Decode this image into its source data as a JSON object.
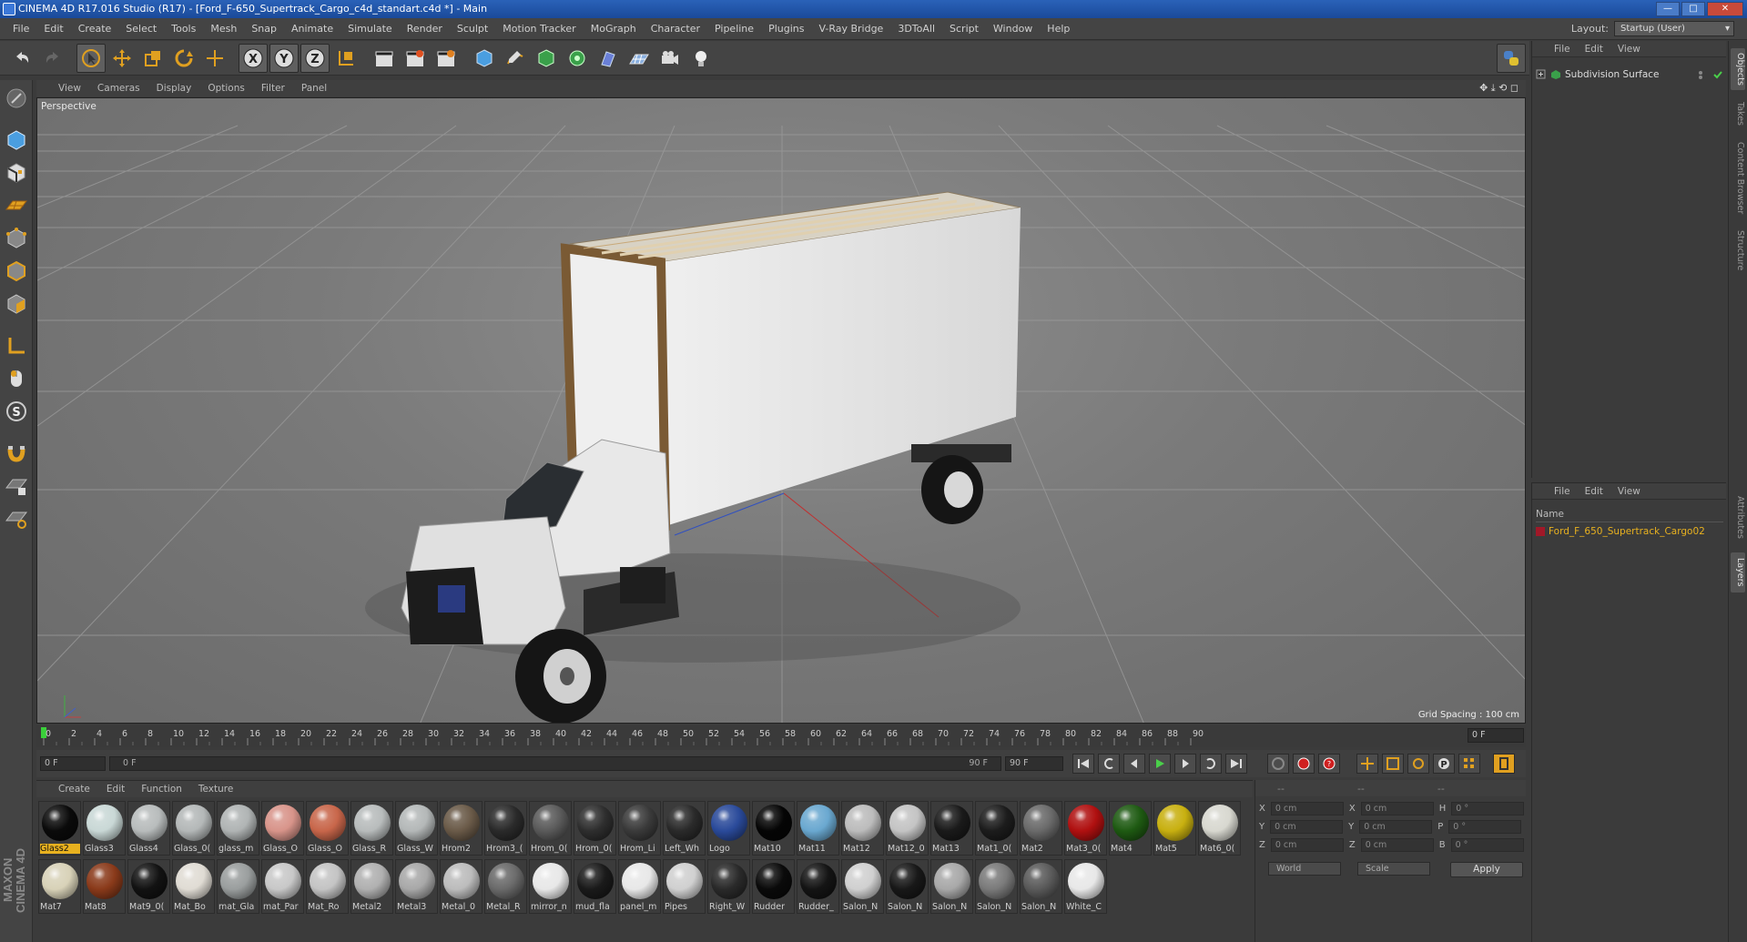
{
  "window": {
    "title": "CINEMA 4D R17.016 Studio (R17) - [Ford_F-650_Supertrack_Cargo_c4d_standart.c4d *] - Main",
    "btn_min": "—",
    "btn_max": "□",
    "btn_close": "✕"
  },
  "menu": [
    "File",
    "Edit",
    "Create",
    "Select",
    "Tools",
    "Mesh",
    "Snap",
    "Animate",
    "Simulate",
    "Render",
    "Sculpt",
    "Motion Tracker",
    "MoGraph",
    "Character",
    "Pipeline",
    "Plugins",
    "V-Ray Bridge",
    "3DToAll",
    "Script",
    "Window",
    "Help"
  ],
  "layout": {
    "label": "Layout:",
    "value": "Startup (User)"
  },
  "viewport": {
    "menu": [
      "View",
      "Cameras",
      "Display",
      "Options",
      "Filter",
      "Panel"
    ],
    "nav_icons": "✥ ⤓ ⟲ ◻",
    "label": "Perspective",
    "grid_spacing": "Grid Spacing : 100 cm"
  },
  "timeline": {
    "ticks": [
      "0",
      "2",
      "4",
      "6",
      "8",
      "10",
      "12",
      "14",
      "16",
      "18",
      "20",
      "22",
      "24",
      "26",
      "28",
      "30",
      "32",
      "34",
      "36",
      "38",
      "40",
      "42",
      "44",
      "46",
      "48",
      "50",
      "52",
      "54",
      "56",
      "58",
      "60",
      "62",
      "64",
      "66",
      "68",
      "70",
      "72",
      "74",
      "76",
      "78",
      "80",
      "82",
      "84",
      "86",
      "88",
      "90"
    ],
    "current_frame": "0 F"
  },
  "playback": {
    "start": "0 F",
    "slider_start": "0 F",
    "slider_end": "90 F",
    "end": "90 F"
  },
  "materials": {
    "menu": [
      "Create",
      "Edit",
      "Function",
      "Texture"
    ],
    "row1": [
      {
        "name": "Glass2",
        "color": "#0a0a0a",
        "selected": true
      },
      {
        "name": "Glass3",
        "color": "#c9d8d6"
      },
      {
        "name": "Glass4",
        "color": "#b8bcbc"
      },
      {
        "name": "Glass_0(",
        "color": "#b4b8b8"
      },
      {
        "name": "glass_m",
        "color": "#b0b4b4"
      },
      {
        "name": "Glass_O",
        "color": "#d8948a"
      },
      {
        "name": "Glass_O",
        "color": "#c8664a"
      },
      {
        "name": "Glass_R",
        "color": "#b8bcbc"
      },
      {
        "name": "Glass_W",
        "color": "#b4b8b8"
      },
      {
        "name": "Hrom2",
        "color": "#6a5a48"
      },
      {
        "name": "Hrom3_(",
        "color": "#2a2a2a"
      },
      {
        "name": "Hrom_0(",
        "color": "#5a5a5a"
      },
      {
        "name": "Hrom_0(",
        "color": "#2e2e2e"
      },
      {
        "name": "Hrom_Li",
        "color": "#3a3a3a"
      },
      {
        "name": "Left_Wh",
        "color": "#2a2a2a"
      },
      {
        "name": "Logo",
        "color": "#2a4a9a"
      },
      {
        "name": "Mat10",
        "color": "#050505"
      },
      {
        "name": "Mat11",
        "color": "#6aa8d0"
      },
      {
        "name": "Mat12",
        "color": "#bcbcbc"
      },
      {
        "name": "Mat12_0",
        "color": "#c4c4c4"
      },
      {
        "name": "Mat13",
        "color": "#1a1a1a"
      },
      {
        "name": "Mat1_0(",
        "color": "#1c1c1c"
      },
      {
        "name": "Mat2",
        "color": "#6a6a6a"
      },
      {
        "name": "Mat3_0(",
        "color": "#b01010"
      },
      {
        "name": "Mat4",
        "color": "#1e5a12"
      },
      {
        "name": "Mat5",
        "color": "#c8b010"
      },
      {
        "name": "Mat6_0(",
        "color": "#d8d8d0"
      }
    ],
    "row2": [
      {
        "name": "Mat7",
        "color": "#d8d2b8"
      },
      {
        "name": "Mat8",
        "color": "#8a3a1a"
      },
      {
        "name": "Mat9_0(",
        "color": "#121212"
      },
      {
        "name": "Mat_Bo",
        "color": "#e0dcd4"
      },
      {
        "name": "mat_Gla",
        "color": "#9a9e9e"
      },
      {
        "name": "mat_Par",
        "color": "#c8c8c8"
      },
      {
        "name": "Mat_Ro",
        "color": "#c4c4c4"
      },
      {
        "name": "Metal2",
        "color": "#b0b0b0"
      },
      {
        "name": "Metal3",
        "color": "#a8a8a8"
      },
      {
        "name": "Metal_0",
        "color": "#bcbcbc"
      },
      {
        "name": "Metal_R",
        "color": "#6a6a6a"
      },
      {
        "name": "mirror_n",
        "color": "#e8e8e8"
      },
      {
        "name": "mud_fla",
        "color": "#1a1a1a"
      },
      {
        "name": "panel_m",
        "color": "#e8e8e8"
      },
      {
        "name": "Pipes",
        "color": "#d0d0d0"
      },
      {
        "name": "Right_W",
        "color": "#2a2a2a"
      },
      {
        "name": "Rudder",
        "color": "#0a0a0a"
      },
      {
        "name": "Rudder_",
        "color": "#141414"
      },
      {
        "name": "Salon_N",
        "color": "#d0d0d0"
      },
      {
        "name": "Salon_N",
        "color": "#181818"
      },
      {
        "name": "Salon_N",
        "color": "#a8a8a8"
      },
      {
        "name": "Salon_N",
        "color": "#7a7a7a"
      },
      {
        "name": "Salon_N",
        "color": "#5a5a5a"
      },
      {
        "name": "White_C",
        "color": "#e8e8e8"
      }
    ]
  },
  "coords": {
    "headers": [
      "--",
      "--",
      "--"
    ],
    "rows": [
      {
        "a": "X",
        "av": "0 cm",
        "b": "X",
        "bv": "0 cm",
        "c": "H",
        "cv": "0 °"
      },
      {
        "a": "Y",
        "av": "0 cm",
        "b": "Y",
        "bv": "0 cm",
        "c": "P",
        "cv": "0 °"
      },
      {
        "a": "Z",
        "av": "0 cm",
        "b": "Z",
        "bv": "0 cm",
        "c": "B",
        "cv": "0 °"
      }
    ],
    "world": "World",
    "scale": "Scale",
    "apply": "Apply"
  },
  "objects": {
    "menu": [
      "File",
      "Edit",
      "View"
    ],
    "item": "Subdivision Surface"
  },
  "layers": {
    "menu": [
      "File",
      "Edit",
      "View"
    ],
    "name_header": "Name",
    "item": "Ford_F_650_Supertrack_Cargo02"
  },
  "side_tabs": [
    "Objects",
    "Takes",
    "Content Browser",
    "Structure",
    "Attributes",
    "Layers"
  ],
  "brand": "MAXON CINEMA 4D"
}
